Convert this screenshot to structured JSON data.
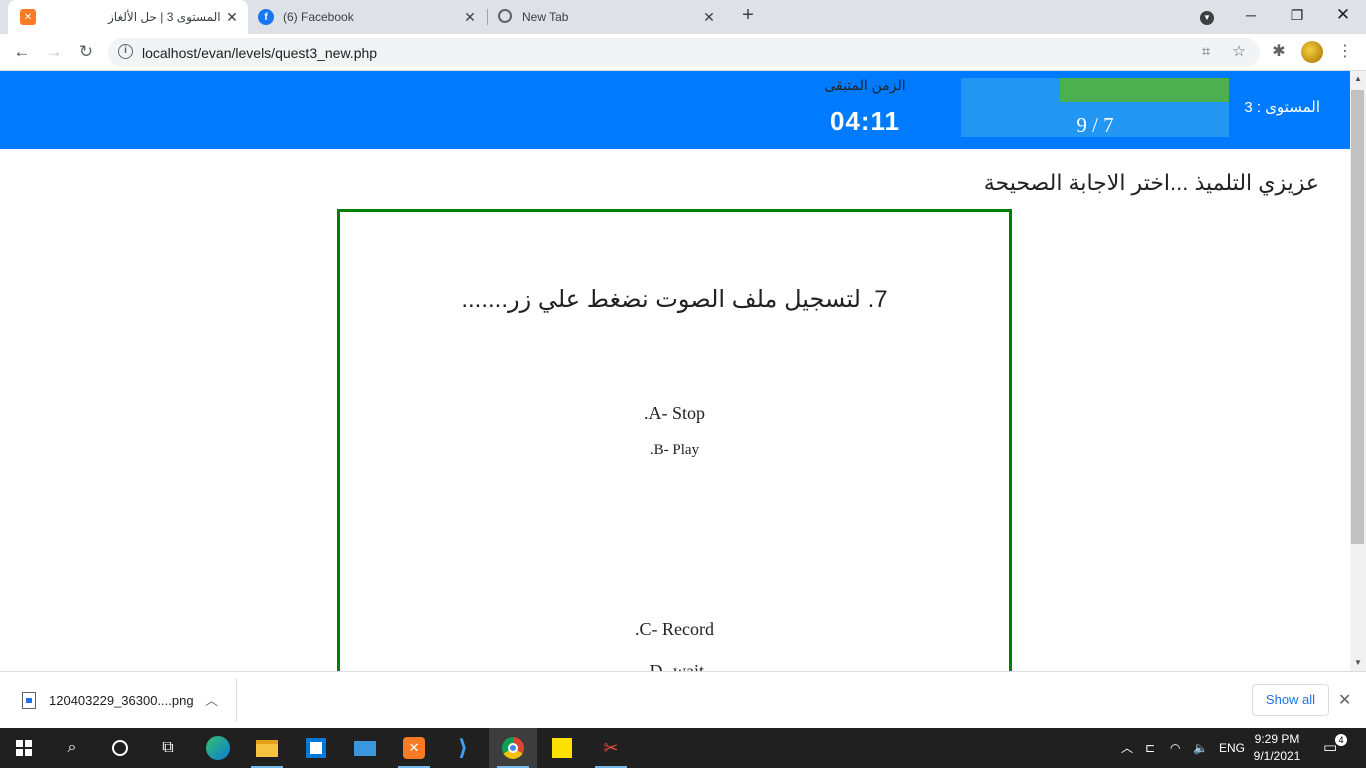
{
  "browser": {
    "tabs": [
      {
        "title": "المستوى 3 | حل الألغاز",
        "icon": "xampp-icon",
        "active": true
      },
      {
        "title": "(6) Facebook",
        "icon": "facebook-icon",
        "active": false
      },
      {
        "title": "New Tab",
        "icon": "chrome-icon",
        "active": false
      }
    ],
    "url": "localhost/evan/levels/quest3_new.php"
  },
  "page": {
    "level_label": "المستوى : 3",
    "progress": {
      "current": 7,
      "total": 9,
      "text": "9 / 7",
      "fill_fraction": 0.63
    },
    "time_label": "الزمن المتبقى",
    "time_value": "04:11",
    "instruction": "عزيزي التلميذ ...اختر الاجابة الصحيحة",
    "question": "7. لتسجيل ملف الصوت نضغط علي زر.......",
    "options": [
      {
        "label": ".A- Stop"
      },
      {
        "label": ".B- Play"
      },
      {
        "label": ".C- Record"
      },
      {
        "label": ".D- wait"
      }
    ]
  },
  "downloads": {
    "filename": "120403229_36300....png",
    "show_all": "Show all"
  },
  "taskbar": {
    "language": "ENG",
    "time": "9:29 PM",
    "date": "9/1/2021",
    "notifications": "4"
  },
  "colors": {
    "header": "#007bff",
    "progress_bg": "#2196f3",
    "progress_fill": "#4caf50",
    "question_border": "#008000"
  }
}
